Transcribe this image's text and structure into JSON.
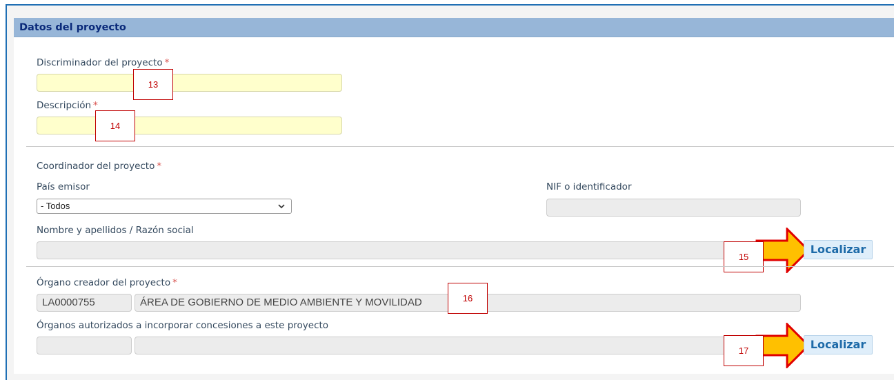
{
  "panel": {
    "title": "Datos del proyecto"
  },
  "fields": {
    "discriminador": {
      "label": "Discriminador del proyecto",
      "required_mark": "*",
      "value": ""
    },
    "descripcion": {
      "label": "Descripción",
      "required_mark": "*",
      "value": ""
    },
    "coordinador": {
      "label": "Coordinador del proyecto",
      "required_mark": "*"
    },
    "pais_emisor": {
      "label": "País emisor",
      "selected": "- Todos"
    },
    "nif": {
      "label": "NIF o identificador",
      "value": ""
    },
    "nombre": {
      "label": "Nombre y apellidos / Razón social",
      "value": ""
    },
    "organo_creador": {
      "label": "Órgano creador del proyecto",
      "required_mark": "*",
      "code": "LA0000755",
      "name": "ÁREA DE GOBIERNO DE MEDIO AMBIENTE Y MOVILIDAD"
    },
    "organos_autorizados": {
      "label": "Órganos autorizados a incorporar concesiones a este proyecto",
      "code": "",
      "name": ""
    }
  },
  "buttons": {
    "localizar_1": "Localizar",
    "localizar_2": "Localizar"
  },
  "callouts": {
    "c13": "13",
    "c14": "14",
    "c15": "15",
    "c16": "16",
    "c17": "17"
  },
  "icons": {
    "select": "chevron-down-icon",
    "arrow": "arrow-right-icon"
  },
  "colors": {
    "header_bg": "#97b6d8",
    "header_text": "#0a2a7a",
    "required_field_bg": "#ffffcc",
    "readonly_bg": "#ececec",
    "arrow_fill": "#ffc000",
    "arrow_outline": "#e00000",
    "button_bg": "#dfeefa",
    "button_text": "#1d6aa8"
  }
}
